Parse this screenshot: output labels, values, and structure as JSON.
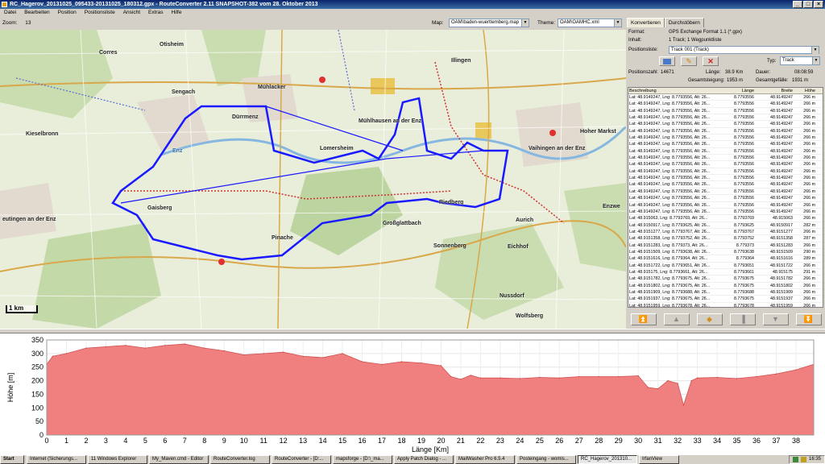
{
  "window": {
    "title": "RC_Hagerov_20131025_095433-20131025_180312.gpx - RouteConverter 2.11 SNAPSHOT-382 vom 28. Oktober 2013",
    "min": "_",
    "max": "□",
    "close": "×"
  },
  "menu": [
    "Datei",
    "Bearbeiten",
    "Position",
    "Positionsliste",
    "Ansicht",
    "Extras",
    "Hilfe"
  ],
  "mapbar": {
    "zoom_label": "Zoom:",
    "zoom_value": "13",
    "map_label": "Map:",
    "map_value": "OAM\\baden-wuerttemberg.map",
    "theme_label": "Theme:",
    "theme_value": "OAM\\OAMHC.xml"
  },
  "map": {
    "places": [
      {
        "name": "Otisheim"
      },
      {
        "name": "Corres"
      },
      {
        "name": "Sengach"
      },
      {
        "name": "Mühlacker"
      },
      {
        "name": "Dürrmenz"
      },
      {
        "name": "Kieselbronn"
      },
      {
        "name": "Lomersheim"
      },
      {
        "name": "Mühlhausen an der Enz"
      },
      {
        "name": "Illingen"
      },
      {
        "name": "Hoher Markst"
      },
      {
        "name": "Vaihingen an der Enz"
      },
      {
        "name": "Gaisberg"
      },
      {
        "name": "Riedberg"
      },
      {
        "name": "Großglattbach"
      },
      {
        "name": "Aurich"
      },
      {
        "name": "Enzwe"
      },
      {
        "name": "eutingen an der Enz"
      },
      {
        "name": "Pinache"
      },
      {
        "name": "Sonnenberg"
      },
      {
        "name": "Eichhof"
      },
      {
        "name": "Nussdorf"
      },
      {
        "name": "Wolfsberg"
      },
      {
        "name": "Enz"
      }
    ],
    "scale": "1 km"
  },
  "panel": {
    "tabs": [
      "Konvertieren",
      "Durchstöbern"
    ],
    "format_label": "Format:",
    "format_value": "GPS Exchange Format 1.1 (*.gpx)",
    "inhalt_label": "Inhalt:",
    "inhalt_value": "1 Track; 1 Wegpunktliste",
    "posliste_label": "Positionsliste:",
    "posliste_value": "Track 001 (Track)",
    "typ_label": "Typ:",
    "typ_value": "Track",
    "stats": {
      "poszahl_label": "Positionszahl:",
      "poszahl_value": "14671",
      "laenge_label": "Länge:",
      "laenge_value": "38.9 Km",
      "dauer_label": "Dauer:",
      "dauer_value": "08:08:59",
      "steigung_label": "Gesamtsteigung:",
      "steigung_value": "1953 m",
      "gefaelle_label": "Gesamtgefälle:",
      "gefaelle_value": "1931 m"
    },
    "table": {
      "headers": [
        "Beschreibung",
        "Länge",
        "Breite",
        "Höhe"
      ],
      "rows": [
        [
          "Lat: 48.9149247, Lng: 8.7793556, Alt: 26...",
          "8.7793556",
          "48.9149247",
          "266 m"
        ],
        [
          "Lat: 48.9149247, Lng: 8.7793556, Alt: 26...",
          "8.7793556",
          "48.9149247",
          "266 m"
        ],
        [
          "Lat: 48.9149247, Lng: 8.7793556, Alt: 26...",
          "8.7793556",
          "48.9149247",
          "266 m"
        ],
        [
          "Lat: 48.9149247, Lng: 8.7793556, Alt: 26...",
          "8.7793556",
          "48.9149247",
          "266 m"
        ],
        [
          "Lat: 48.9149247, Lng: 8.7793556, Alt: 26...",
          "8.7793556",
          "48.9149247",
          "266 m"
        ],
        [
          "Lat: 48.9149247, Lng: 8.7793556, Alt: 26...",
          "8.7793556",
          "48.9149247",
          "266 m"
        ],
        [
          "Lat: 48.9149247, Lng: 8.7793556, Alt: 26...",
          "8.7793556",
          "48.9149247",
          "266 m"
        ],
        [
          "Lat: 48.9149247, Lng: 8.7793556, Alt: 26...",
          "8.7793556",
          "48.9149247",
          "266 m"
        ],
        [
          "Lat: 48.9149247, Lng: 8.7793556, Alt: 26...",
          "8.7793556",
          "48.9149247",
          "266 m"
        ],
        [
          "Lat: 48.9149247, Lng: 8.7793556, Alt: 26...",
          "8.7793556",
          "48.9149247",
          "266 m"
        ],
        [
          "Lat: 48.9149247, Lng: 8.7793556, Alt: 26...",
          "8.7793556",
          "48.9149247",
          "266 m"
        ],
        [
          "Lat: 48.9149247, Lng: 8.7793556, Alt: 26...",
          "8.7793556",
          "48.9149247",
          "266 m"
        ],
        [
          "Lat: 48.9149247, Lng: 8.7793556, Alt: 26...",
          "8.7793556",
          "48.9149247",
          "266 m"
        ],
        [
          "Lat: 48.9149247, Lng: 8.7793556, Alt: 26...",
          "8.7793556",
          "48.9149247",
          "266 m"
        ],
        [
          "Lat: 48.9149247, Lng: 8.7793556, Alt: 26...",
          "8.7793556",
          "48.9149247",
          "266 m"
        ],
        [
          "Lat: 48.9149247, Lng: 8.7793556, Alt: 26...",
          "8.7793556",
          "48.9149247",
          "266 m"
        ],
        [
          "Lat: 48.9149247, Lng: 8.7793556, Alt: 26...",
          "8.7793556",
          "48.9149247",
          "266 m"
        ],
        [
          "Lat: 48.9149247, Lng: 8.7793556, Alt: 26...",
          "8.7793556",
          "48.9149247",
          "266 m"
        ],
        [
          "Lat: 48.915063, Lng: 8.7793769, Alt: 26...",
          "8.7793769",
          "48.915063",
          "266 m"
        ],
        [
          "Lat: 48.9150917, Lng: 8.7793625, Alt: 26...",
          "8.7793625",
          "48.9150917",
          "282 m"
        ],
        [
          "Lat: 48.9151277, Lng: 8.7793767, Alt: 26...",
          "8.7793767",
          "48.9151277",
          "266 m"
        ],
        [
          "Lat: 48.9151358, Lng: 8.7793752, Alt: 26...",
          "8.7793752",
          "48.9151358",
          "287 m"
        ],
        [
          "Lat: 48.9151283, Lng: 8.779373, Alt: 26...",
          "8.779373",
          "48.9151283",
          "266 m"
        ],
        [
          "Lat: 48.9151509, Lng: 8.7793638, Alt: 26...",
          "8.7793638",
          "48.9151509",
          "290 m"
        ],
        [
          "Lat: 48.9151616, Lng: 8.779364, Alt: 26...",
          "8.779364",
          "48.9151616",
          "289 m"
        ],
        [
          "Lat: 48.9151722, Lng: 8.7793651, Alt: 26...",
          "8.7793651",
          "48.9151722",
          "266 m"
        ],
        [
          "Lat: 48.915175, Lng: 8.7793661, Alt: 26...",
          "8.7793661",
          "48.915175",
          "291 m"
        ],
        [
          "Lat: 48.9151782, Lng: 8.7793675, Alt: 26...",
          "8.7793675",
          "48.9151782",
          "266 m"
        ],
        [
          "Lat: 48.9151802, Lng: 8.7793675, Alt: 26...",
          "8.7793675",
          "48.9151802",
          "266 m"
        ],
        [
          "Lat: 48.9151909, Lng: 8.7793688, Alt: 26...",
          "8.7793688",
          "48.9151909",
          "266 m"
        ],
        [
          "Lat: 48.9151937, Lng: 8.7793675, Alt: 26...",
          "8.7793675",
          "48.9151937",
          "266 m"
        ],
        [
          "Lat: 48.9151959, Lng: 8.7793678, Alt: 26...",
          "8.7793678",
          "48.9151959",
          "266 m"
        ],
        [
          "Lat: 48.9151815, Lng: 8.7793693, Alt: 26...",
          "8.7793693",
          "48.9151815",
          "266 m"
        ]
      ]
    },
    "nav": [
      "⏫",
      "▲",
      "◆",
      "▐",
      "▼",
      "⏬"
    ]
  },
  "chart_data": {
    "type": "area",
    "ylabel": "Höhe [m]",
    "xlabel": "Länge [Km]",
    "xlim": [
      0,
      38.9
    ],
    "ylim": [
      0,
      350
    ],
    "yticks": [
      0,
      50,
      100,
      150,
      200,
      250,
      300,
      350
    ],
    "xticks": [
      0,
      1,
      2,
      3,
      4,
      5,
      6,
      7,
      8,
      9,
      10,
      11,
      12,
      13,
      14,
      15,
      16,
      17,
      18,
      19,
      20,
      21,
      22,
      23,
      24,
      25,
      26,
      27,
      28,
      29,
      30,
      31,
      32,
      33,
      34,
      35,
      36,
      37,
      38
    ],
    "grid": true,
    "color": "#f08080",
    "x": [
      0,
      0.3,
      1,
      2,
      3,
      4,
      5,
      6,
      7,
      8,
      9,
      10,
      11,
      12,
      13,
      14,
      15,
      16,
      17,
      18,
      19,
      20,
      20.5,
      21,
      21.5,
      22,
      23,
      24,
      25,
      26,
      27,
      28,
      29,
      30,
      30.5,
      31,
      31.5,
      32,
      32.3,
      32.7,
      33,
      34,
      35,
      36,
      37,
      38,
      38.9
    ],
    "values": [
      260,
      290,
      300,
      320,
      325,
      330,
      320,
      330,
      335,
      320,
      310,
      295,
      300,
      305,
      290,
      285,
      300,
      270,
      260,
      270,
      265,
      255,
      215,
      205,
      220,
      210,
      210,
      208,
      212,
      210,
      215,
      215,
      215,
      218,
      175,
      170,
      200,
      190,
      110,
      200,
      210,
      212,
      208,
      215,
      225,
      240,
      260
    ]
  },
  "taskbar": {
    "start": "Start",
    "tasks": [
      "Internet (Sicherungs...",
      "11 Windows Explorer",
      "My_Maven.cmd - Editor",
      "RouteConverter.log",
      "RouteConverter - [D:...",
      "mapsforge - [D:\\_ma...",
      "Apply Patch Dialog - ...",
      "MailWasher Pro 6.5.4",
      "Posteingang - womis...",
      "RC_Hagerov_201310...",
      "IrfanView"
    ],
    "active": 9,
    "clock": "16:35"
  },
  "colors": {
    "track": "#1a1aff",
    "accent": "#0a246a",
    "profile_fill": "#f08080"
  }
}
